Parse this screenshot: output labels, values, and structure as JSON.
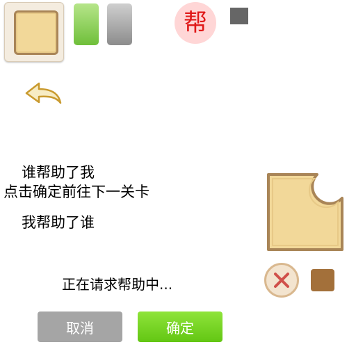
{
  "help_badge": {
    "label": "帮"
  },
  "dialog": {
    "line1": "谁帮助了我",
    "line2": "点击确定前往下一关卡",
    "line3": "我帮助了谁"
  },
  "status": {
    "text": "正在请求帮助中..."
  },
  "buttons": {
    "cancel": "取消",
    "confirm": "确定"
  },
  "icons": {
    "back": "back-arrow-icon",
    "close": "close-icon"
  },
  "colors": {
    "confirm": "#7ad626",
    "cancel": "#a5a5a5",
    "help_text": "#e01919",
    "tile_fill": "#f2d899",
    "tile_border": "#a98557",
    "close_x": "#d0504a"
  }
}
